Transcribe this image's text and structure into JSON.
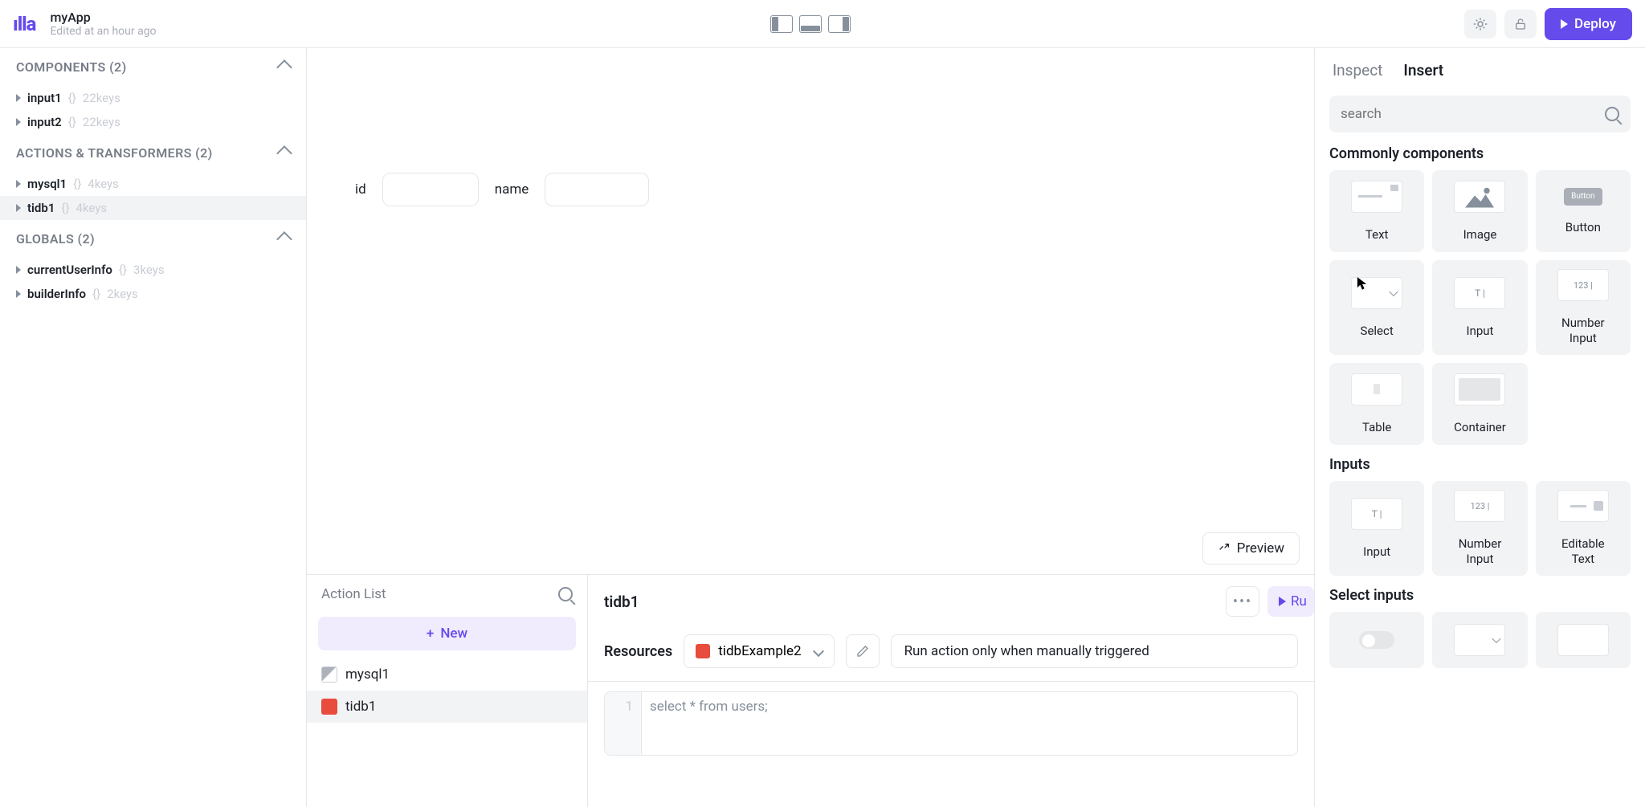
{
  "app": {
    "name": "myApp",
    "edited": "Edited at an hour ago"
  },
  "deploy_label": "Deploy",
  "left": {
    "sections": [
      {
        "title": "COMPONENTS (2)",
        "items": [
          {
            "name": "input1",
            "meta": "22keys"
          },
          {
            "name": "input2",
            "meta": "22keys"
          }
        ]
      },
      {
        "title": "ACTIONS & TRANSFORMERS (2)",
        "items": [
          {
            "name": "mysql1",
            "meta": "4keys"
          },
          {
            "name": "tidb1",
            "meta": "4keys",
            "selected": true
          }
        ]
      },
      {
        "title": "GLOBALS (2)",
        "items": [
          {
            "name": "currentUserInfo",
            "meta": "3keys"
          },
          {
            "name": "builderInfo",
            "meta": "2keys"
          }
        ]
      }
    ]
  },
  "canvas": {
    "field1_label": "id",
    "field2_label": "name",
    "preview_label": "Preview"
  },
  "bottom": {
    "actionlist_title": "Action List",
    "new_label": "New",
    "items": [
      {
        "name": "mysql1",
        "type": "mysql"
      },
      {
        "name": "tidb1",
        "type": "tidb",
        "selected": true
      }
    ],
    "current_action": "tidb1",
    "run_label": "Ru",
    "resources_label": "Resources",
    "resource_selected": "tidbExample2",
    "trigger_text": "Run action only when manually triggered",
    "line_no": "1",
    "code": "select * from users;"
  },
  "right": {
    "tab_inspect": "Inspect",
    "tab_insert": "Insert",
    "search_placeholder": "search",
    "section_common": "Commonly components",
    "section_inputs": "Inputs",
    "section_selects": "Select inputs",
    "c": {
      "text": "Text",
      "image": "Image",
      "button": "Button",
      "select": "Select",
      "input": "Input",
      "number_input": "Number\nInput",
      "table": "Table",
      "container": "Container",
      "input2": "Input",
      "number_input2": "Number\nInput",
      "editable_text": "Editable\nText"
    },
    "btn_preview_text": "Button"
  }
}
